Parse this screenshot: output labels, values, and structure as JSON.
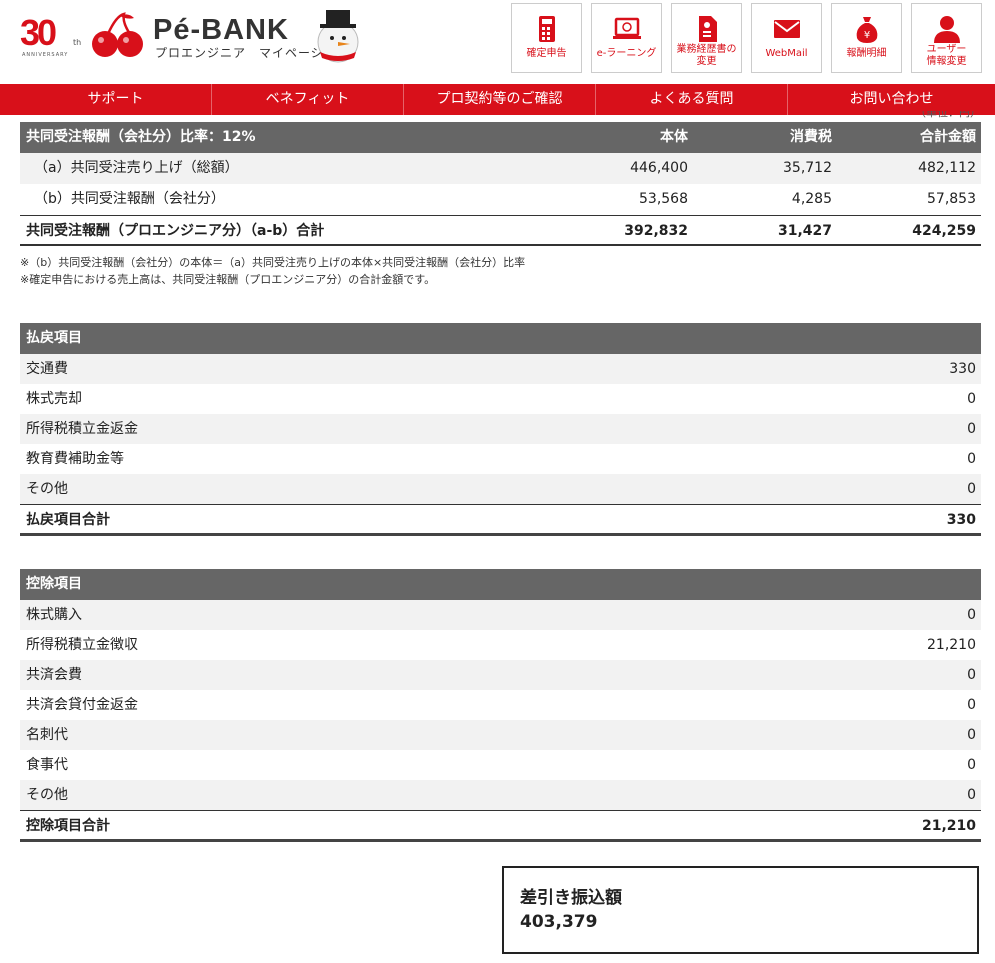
{
  "header": {
    "anniversary_number": "30",
    "anniversary_suffix": "th",
    "anniversary_text": "ANNIVERSARY",
    "brand": "Pé-BANK",
    "subbrand": "プロエンジニア　マイページ"
  },
  "toolbar": [
    {
      "label": "確定申告",
      "icon": "calculator-icon"
    },
    {
      "label": "e-ラーニング",
      "icon": "laptop-icon"
    },
    {
      "label": "業務経歴書の\n変更",
      "icon": "document-icon"
    },
    {
      "label": "WebMail",
      "icon": "mail-icon"
    },
    {
      "label": "報酬明細",
      "icon": "money-bag-icon"
    },
    {
      "label": "ユーザー\n情報変更",
      "icon": "user-icon"
    }
  ],
  "nav": [
    "サポート",
    "ベネフィット",
    "プロ契約等のご確認",
    "よくある質問",
    "お問い合わせ"
  ],
  "unit": "（単位：円）",
  "joint": {
    "title": "共同受注報酬（会社分）比率：12%",
    "col1": "本体",
    "col2": "消費税",
    "col3": "合計金額",
    "rows": [
      {
        "label": "（a）共同受注売り上げ（総額）",
        "v1": "446,400",
        "v2": "35,712",
        "v3": "482,112"
      },
      {
        "label": "（b）共同受注報酬（会社分）",
        "v1": "53,568",
        "v2": "4,285",
        "v3": "57,853"
      }
    ],
    "total": {
      "label": "共同受注報酬（プロエンジニア分）（a-b）合計",
      "v1": "392,832",
      "v2": "31,427",
      "v3": "424,259"
    },
    "note1": "※（b）共同受注報酬（会社分）の本体＝（a）共同受注売り上げの本体×共同受注報酬（会社分）比率",
    "note2": "※確定申告における売上高は、共同受注報酬（プロエンジニア分）の合計金額です。"
  },
  "refund": {
    "title": "払戻項目",
    "rows": [
      {
        "label": "交通費",
        "value": "330"
      },
      {
        "label": "株式売却",
        "value": "0"
      },
      {
        "label": "所得税積立金返金",
        "value": "0"
      },
      {
        "label": "教育費補助金等",
        "value": "0"
      },
      {
        "label": "その他",
        "value": "0"
      }
    ],
    "total": {
      "label": "払戻項目合計",
      "value": "330"
    }
  },
  "deduction": {
    "title": "控除項目",
    "rows": [
      {
        "label": "株式購入",
        "value": "0"
      },
      {
        "label": "所得税積立金徴収",
        "value": "21,210"
      },
      {
        "label": "共済会費",
        "value": "0"
      },
      {
        "label": "共済会貸付金返金",
        "value": "0"
      },
      {
        "label": "名刺代",
        "value": "0"
      },
      {
        "label": "食事代",
        "value": "0"
      },
      {
        "label": "その他",
        "value": "0"
      }
    ],
    "total": {
      "label": "控除項目合計",
      "value": "21,210"
    }
  },
  "net": {
    "label": "差引き振込額",
    "value": "403,379"
  },
  "colors": {
    "brand_red": "#d8101a",
    "header_gray": "#666666",
    "row_alt": "#f2f2f2"
  }
}
